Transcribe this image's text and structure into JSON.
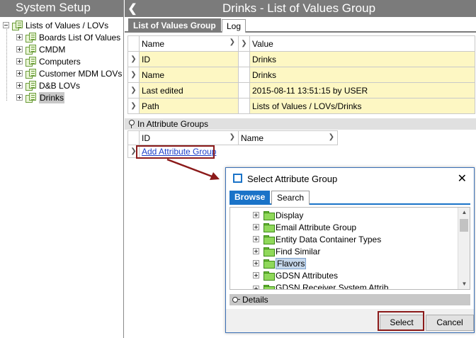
{
  "left_panel": {
    "title": "System Setup",
    "tree": [
      {
        "label": "Lists of Values / LOVs",
        "expanded": true,
        "selected": false
      },
      {
        "label": "Boards List Of Values",
        "expanded": false,
        "selected": false
      },
      {
        "label": "CMDM",
        "expanded": false,
        "selected": false
      },
      {
        "label": "Computers",
        "expanded": false,
        "selected": false
      },
      {
        "label": "Customer MDM LOVs",
        "expanded": false,
        "selected": false
      },
      {
        "label": "D&B LOVs",
        "expanded": false,
        "selected": false
      },
      {
        "label": "Drinks",
        "expanded": false,
        "selected": true
      }
    ]
  },
  "right_panel": {
    "back_icon": "chevron-left-icon",
    "title": "Drinks - List of Values Group",
    "tabs": [
      {
        "label": "List of Values Group",
        "active": true
      },
      {
        "label": "Log",
        "active": false
      }
    ],
    "properties": {
      "columns": [
        "Name",
        "Value"
      ],
      "rows": [
        {
          "name": "ID",
          "value": "Drinks"
        },
        {
          "name": "Name",
          "value": "Drinks"
        },
        {
          "name": "Last edited",
          "value": "2015-08-11 13:51:15 by USER"
        },
        {
          "name": "Path",
          "value": "Lists of Values / LOVs/Drinks"
        }
      ]
    },
    "attribute_groups": {
      "section_title": "In Attribute Groups",
      "columns": [
        "ID",
        "Name"
      ],
      "add_link": "Add Attribute Group"
    }
  },
  "dialog": {
    "title": "Select Attribute Group",
    "close_icon": "close-icon",
    "tabs": [
      {
        "label": "Browse",
        "active": true
      },
      {
        "label": "Search",
        "active": false
      }
    ],
    "tree": [
      {
        "label": "Display",
        "selected": false
      },
      {
        "label": "Email Attribute Group",
        "selected": false
      },
      {
        "label": "Entity Data Container Types",
        "selected": false
      },
      {
        "label": "Find Similar",
        "selected": false
      },
      {
        "label": "Flavors",
        "selected": true
      },
      {
        "label": "GDSN Attributes",
        "selected": false
      },
      {
        "label": "GDSN Receiver System Attrib...",
        "selected": false
      }
    ],
    "details_label": "Details",
    "buttons": {
      "select": "Select",
      "cancel": "Cancel"
    }
  },
  "colors": {
    "header_gray": "#7b7b7b",
    "row_yellow": "#fdf7c3",
    "highlight_red": "#8b1a1a",
    "dialog_blue": "#1a73c8"
  }
}
